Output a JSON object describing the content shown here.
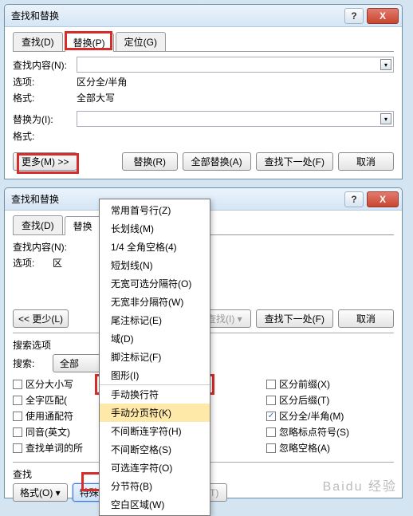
{
  "win1": {
    "title": "查找和替换",
    "tabs": {
      "find": "查找(D)",
      "replace": "替换(P)",
      "goto": "定位(G)"
    },
    "labels": {
      "findwhat": "查找内容(N):",
      "options": "选项:",
      "format": "格式:",
      "replacewith": "替换为(I):",
      "format2": "格式:"
    },
    "values": {
      "options": "区分全/半角",
      "format": "全部大写"
    },
    "buttons": {
      "more": "更多(M) >>",
      "replace": "替换(R)",
      "replaceall": "全部替换(A)",
      "findnext": "查找下一处(F)",
      "cancel": "取消"
    }
  },
  "win2": {
    "title": "查找和替换",
    "tabs": {
      "find": "查找(D)",
      "replace": "替换",
      "more": "..."
    },
    "labels": {
      "findwhat": "查找内容(N):",
      "options": "选项:"
    },
    "values": {
      "options_prefix": "区"
    },
    "buttons": {
      "less": "<< 更少(L)",
      "findin": "中查找(I) ▾",
      "findnext": "查找下一处(F)",
      "cancel": "取消"
    },
    "search_section": "搜索选项",
    "search_label": "搜索:",
    "search_dir": "全部",
    "checks_left": [
      {
        "label": "区分大小写",
        "checked": false
      },
      {
        "label": "全字匹配(",
        "checked": false
      },
      {
        "label": "使用通配符",
        "checked": false
      },
      {
        "label": "同音(英文)",
        "checked": false
      },
      {
        "label": "查找单词的所",
        "checked": false
      }
    ],
    "checks_right": [
      {
        "label": "区分前缀(X)",
        "checked": false
      },
      {
        "label": "区分后缀(T)",
        "checked": false
      },
      {
        "label": "区分全/半角(M)",
        "checked": true
      },
      {
        "label": "忽略标点符号(S)",
        "checked": false
      },
      {
        "label": "忽略空格(A)",
        "checked": false
      }
    ],
    "find_section": "查找",
    "format_btn": "格式(O) ▾",
    "special_btn": "特殊格式(E) ▾",
    "nofmt_btn": "不限定格式(T)"
  },
  "popup": {
    "items_top": [
      "常用首号行(Z)",
      "长划线(M)",
      "1/4 全角空格(4)",
      "短划线(N)",
      "无宽可选分隔符(O)",
      "无宽非分隔符(W)",
      "尾注标记(E)",
      "域(D)",
      "脚注标记(F)",
      "图形(I)"
    ],
    "item_cut": "手动换行符",
    "item_hl": "手动分页符(K)",
    "items_bottom": [
      "不间断连字符(H)",
      "不间断空格(S)",
      "可选连字符(O)",
      "分节符(B)",
      "空白区域(W)"
    ]
  },
  "watermark": "Baidu 经验"
}
